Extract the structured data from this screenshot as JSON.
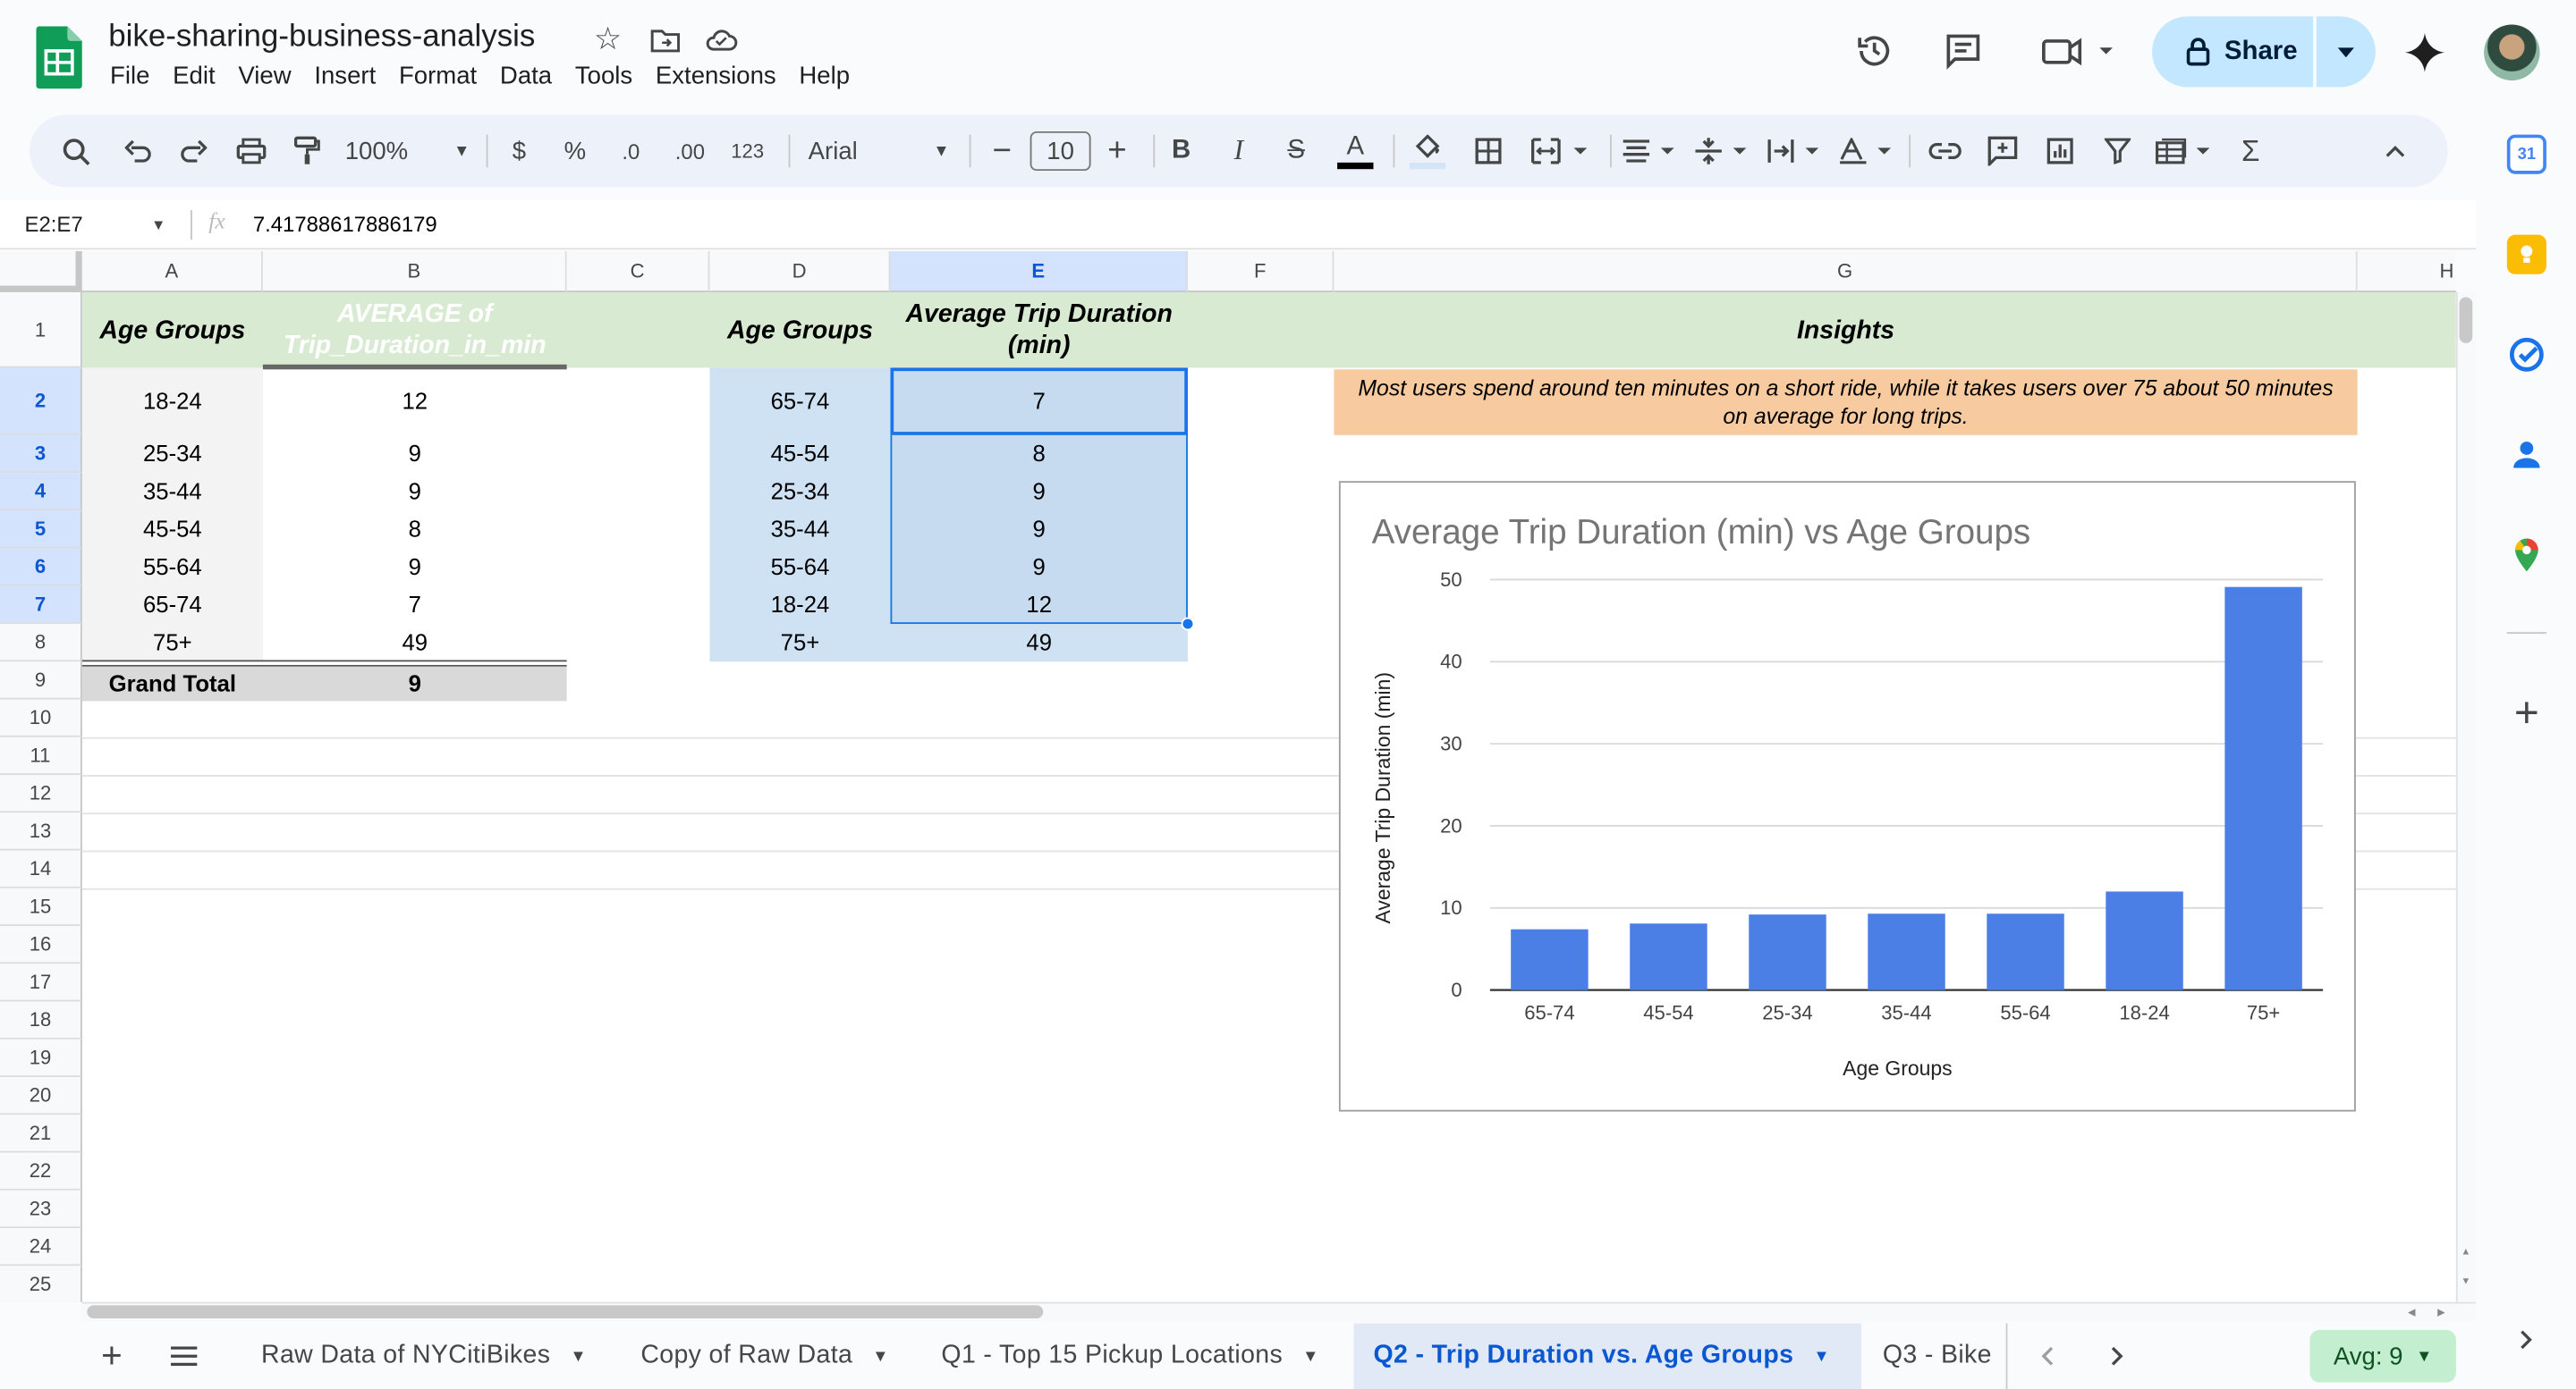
{
  "app": {
    "title": "bike-sharing-business-analysis",
    "menu": [
      "File",
      "Edit",
      "View",
      "Insert",
      "Format",
      "Data",
      "Tools",
      "Extensions",
      "Help"
    ],
    "share_label": "Share"
  },
  "toolbar": {
    "zoom": "100%",
    "currency": "$",
    "percent": "%",
    "decrease_decimal": ".0",
    "increase_decimal": ".00",
    "number_format": "123",
    "font": "Arial",
    "font_size": "10",
    "bold": "B",
    "italic": "I",
    "strikethrough": "S",
    "text_color": "A",
    "sum": "Σ"
  },
  "formula_bar": {
    "name_box": "E2:E7",
    "fx": "fx",
    "value": "7.41788617886179"
  },
  "columns": [
    "A",
    "B",
    "C",
    "D",
    "E",
    "F",
    "G",
    "H"
  ],
  "rows": [
    "1",
    "2",
    "3",
    "4",
    "5",
    "6",
    "7",
    "8",
    "9",
    "10",
    "11",
    "12",
    "13",
    "14",
    "15",
    "16",
    "17",
    "18",
    "19",
    "20",
    "21",
    "22",
    "23",
    "24",
    "25"
  ],
  "pivot": {
    "header_a": "Age Groups",
    "header_b": "AVERAGE of Trip_Duration_in_min",
    "rows": [
      {
        "age": "18-24",
        "avg": "12"
      },
      {
        "age": "25-34",
        "avg": "9"
      },
      {
        "age": "35-44",
        "avg": "9"
      },
      {
        "age": "45-54",
        "avg": "8"
      },
      {
        "age": "55-64",
        "avg": "9"
      },
      {
        "age": "65-74",
        "avg": "7"
      },
      {
        "age": "75+",
        "avg": "49"
      }
    ],
    "total_label": "Grand Total",
    "total_value": "9"
  },
  "sorted_table": {
    "header_d": "Age Groups",
    "header_e": "Average Trip Duration (min)",
    "rows": [
      {
        "age": "65-74",
        "avg": "7"
      },
      {
        "age": "45-54",
        "avg": "8"
      },
      {
        "age": "25-34",
        "avg": "9"
      },
      {
        "age": "35-44",
        "avg": "9"
      },
      {
        "age": "55-64",
        "avg": "9"
      },
      {
        "age": "18-24",
        "avg": "12"
      },
      {
        "age": "75+",
        "avg": "49"
      }
    ]
  },
  "insights": {
    "header": "Insights",
    "text": "Most users spend around ten minutes on a short ride, while it takes users over 75 about 50 minutes on average for long trips."
  },
  "chart_data": {
    "type": "bar",
    "title": "Average Trip Duration (min) vs Age Groups",
    "xlabel": "Age Groups",
    "ylabel": "Average Trip Duration (min)",
    "categories": [
      "65-74",
      "45-54",
      "25-34",
      "35-44",
      "55-64",
      "18-24",
      "75+"
    ],
    "values": [
      7.4,
      8.1,
      9.2,
      9.3,
      9.3,
      12.0,
      49.1
    ],
    "ylim": [
      0,
      50
    ],
    "yticks": [
      "0",
      "10",
      "20",
      "30",
      "40",
      "50"
    ],
    "grid": true,
    "legend": "none",
    "bar_color": "#4c7fe6"
  },
  "tabs": [
    {
      "label": "Raw Data of NYCitiBikes",
      "active": false
    },
    {
      "label": "Copy of Raw Data",
      "active": false
    },
    {
      "label": "Q1 - Top 15 Pickup Locations",
      "active": false
    },
    {
      "label": "Q2 - Trip Duration vs. Age Groups",
      "active": true
    },
    {
      "label": "Q3 - Bike",
      "active": false
    }
  ],
  "status": {
    "summary": "Avg: 9"
  },
  "colors": {
    "header_green": "#d9ead3",
    "insight_orange": "#f7cb9f",
    "selection_blue": "#c6dbf0",
    "range_blue": "#cfe2f3",
    "total_gray": "#d9d9d9",
    "pivot_gray": "#f3f3f3",
    "share_blue": "#c2e7ff",
    "active_tab": "#e1e9f7",
    "avg_green": "#c4eed0"
  }
}
